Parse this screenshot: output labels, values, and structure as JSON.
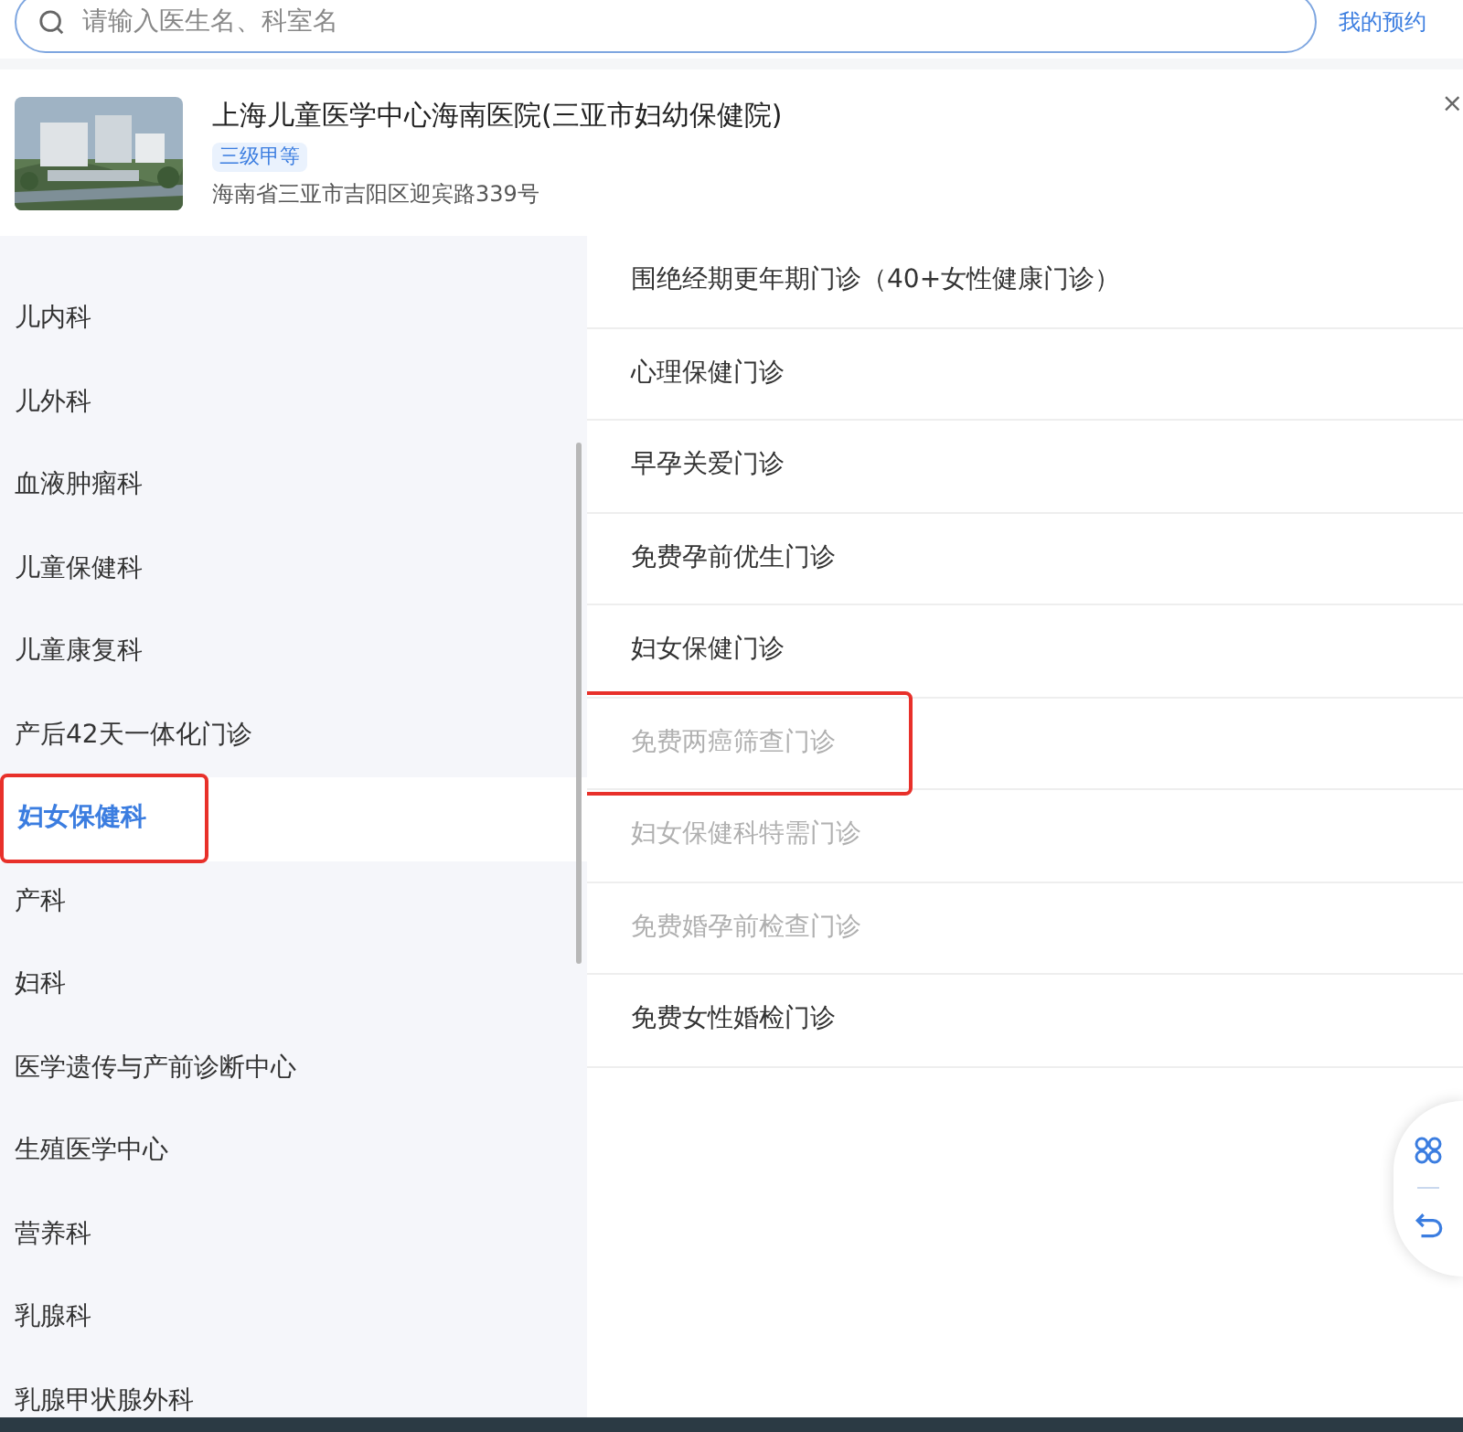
{
  "search": {
    "placeholder": "请输入医生名、科室名"
  },
  "my_appointments": "我的预约",
  "hospital": {
    "name": "上海儿童医学中心海南医院(三亚市妇幼保健院)",
    "level_tag": "三级甲等",
    "address": "海南省三亚市吉阳区迎宾路339号",
    "close": "×"
  },
  "departments": [
    {
      "label": "儿内科",
      "selected": false,
      "annotated": false
    },
    {
      "label": "儿外科",
      "selected": false,
      "annotated": false
    },
    {
      "label": "血液肿瘤科",
      "selected": false,
      "annotated": false
    },
    {
      "label": "儿童保健科",
      "selected": false,
      "annotated": false
    },
    {
      "label": "儿童康复科",
      "selected": false,
      "annotated": false
    },
    {
      "label": "产后42天一体化门诊",
      "selected": false,
      "annotated": false
    },
    {
      "label": "妇女保健科",
      "selected": true,
      "annotated": true
    },
    {
      "label": "产科",
      "selected": false,
      "annotated": false
    },
    {
      "label": "妇科",
      "selected": false,
      "annotated": false
    },
    {
      "label": "医学遗传与产前诊断中心",
      "selected": false,
      "annotated": false
    },
    {
      "label": "生殖医学中心",
      "selected": false,
      "annotated": false
    },
    {
      "label": "营养科",
      "selected": false,
      "annotated": false
    },
    {
      "label": "乳腺科",
      "selected": false,
      "annotated": false
    },
    {
      "label": "乳腺甲状腺外科",
      "selected": false,
      "annotated": false
    }
  ],
  "clinics": [
    {
      "label": "围绝经期更年期门诊（40+女性健康门诊）",
      "disabled": false,
      "annotated": false
    },
    {
      "label": "心理保健门诊",
      "disabled": false,
      "annotated": false
    },
    {
      "label": "早孕关爱门诊",
      "disabled": false,
      "annotated": false
    },
    {
      "label": "免费孕前优生门诊",
      "disabled": false,
      "annotated": false
    },
    {
      "label": "妇女保健门诊",
      "disabled": false,
      "annotated": false
    },
    {
      "label": "免费两癌筛查门诊",
      "disabled": true,
      "annotated": true
    },
    {
      "label": "妇女保健科特需门诊",
      "disabled": true,
      "annotated": false
    },
    {
      "label": "免费婚孕前检查门诊",
      "disabled": true,
      "annotated": false
    },
    {
      "label": "免费女性婚检门诊",
      "disabled": false,
      "annotated": false
    }
  ]
}
